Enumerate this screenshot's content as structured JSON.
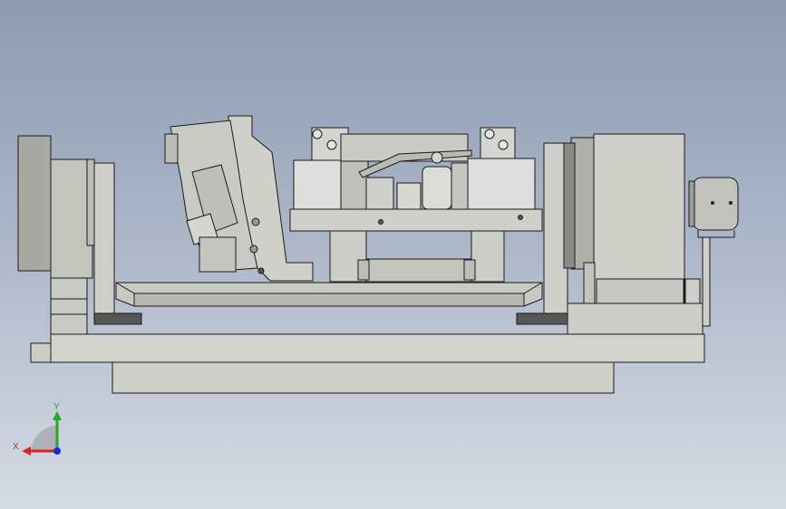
{
  "viewport": {
    "colors": {
      "background_top": "#8d9bb3",
      "background_bottom": "#d6dbe4",
      "part_fill": "#cfcfc9",
      "part_light": "#e0e0da",
      "part_shadow": "#575757",
      "edge": "#1a1a1a"
    }
  },
  "triad": {
    "x_label": "X",
    "y_label": "Y",
    "x_color": "#e0201a",
    "y_color": "#1fa82a",
    "z_color": "#1a2bd6"
  }
}
